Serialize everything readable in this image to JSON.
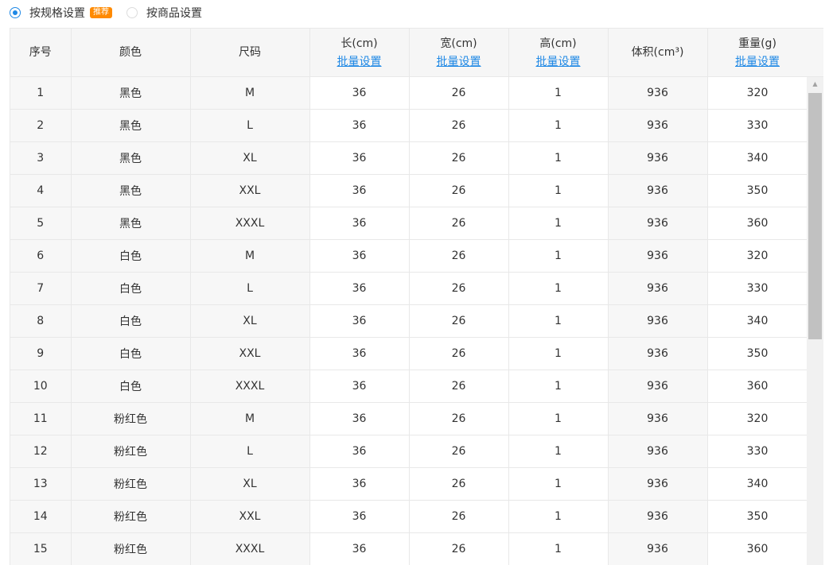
{
  "mode_options": [
    {
      "label": "按规格设置",
      "badge": "推荐",
      "checked": true
    },
    {
      "label": "按商品设置",
      "checked": false
    }
  ],
  "columns": [
    {
      "title": "序号"
    },
    {
      "title": "颜色"
    },
    {
      "title": "尺码"
    },
    {
      "title": "长(cm)",
      "link": "批量设置"
    },
    {
      "title": "宽(cm)",
      "link": "批量设置"
    },
    {
      "title": "高(cm)",
      "link": "批量设置"
    },
    {
      "title": "体积(cm³)"
    },
    {
      "title": "重量(g)",
      "link": "批量设置"
    }
  ],
  "rows": [
    [
      "1",
      "黑色",
      "M",
      "36",
      "26",
      "1",
      "936",
      "320"
    ],
    [
      "2",
      "黑色",
      "L",
      "36",
      "26",
      "1",
      "936",
      "330"
    ],
    [
      "3",
      "黑色",
      "XL",
      "36",
      "26",
      "1",
      "936",
      "340"
    ],
    [
      "4",
      "黑色",
      "XXL",
      "36",
      "26",
      "1",
      "936",
      "350"
    ],
    [
      "5",
      "黑色",
      "XXXL",
      "36",
      "26",
      "1",
      "936",
      "360"
    ],
    [
      "6",
      "白色",
      "M",
      "36",
      "26",
      "1",
      "936",
      "320"
    ],
    [
      "7",
      "白色",
      "L",
      "36",
      "26",
      "1",
      "936",
      "330"
    ],
    [
      "8",
      "白色",
      "XL",
      "36",
      "26",
      "1",
      "936",
      "340"
    ],
    [
      "9",
      "白色",
      "XXL",
      "36",
      "26",
      "1",
      "936",
      "350"
    ],
    [
      "10",
      "白色",
      "XXXL",
      "36",
      "26",
      "1",
      "936",
      "360"
    ],
    [
      "11",
      "粉红色",
      "M",
      "36",
      "26",
      "1",
      "936",
      "320"
    ],
    [
      "12",
      "粉红色",
      "L",
      "36",
      "26",
      "1",
      "936",
      "330"
    ],
    [
      "13",
      "粉红色",
      "XL",
      "36",
      "26",
      "1",
      "936",
      "340"
    ],
    [
      "14",
      "粉红色",
      "XXL",
      "36",
      "26",
      "1",
      "936",
      "350"
    ],
    [
      "15",
      "粉红色",
      "XXXL",
      "36",
      "26",
      "1",
      "936",
      "360"
    ]
  ],
  "colors": {
    "accent": "#1e88e5",
    "badge": "#ff8a00",
    "header_bg": "#f6f6f6",
    "readonly_cell_bg": "#f7f7f7",
    "border": "#e8e8e8"
  },
  "icons": {
    "scroll_up": "scroll-up-arrow-icon"
  },
  "scroll": {
    "up_glyph": "▲"
  }
}
